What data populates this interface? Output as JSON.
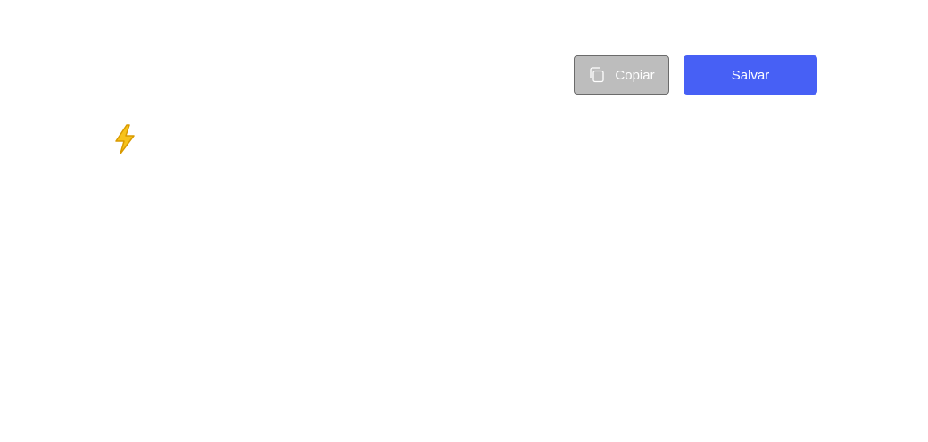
{
  "toolbar": {
    "copy_label": "Copiar",
    "save_label": "Salvar"
  },
  "icons": {
    "copy": "copy-icon",
    "bolt": "lightning-bolt-icon"
  },
  "colors": {
    "primary": "#4760f5",
    "copy_disabled_bg": "#bdbdbd",
    "bolt": "#f5b400"
  }
}
